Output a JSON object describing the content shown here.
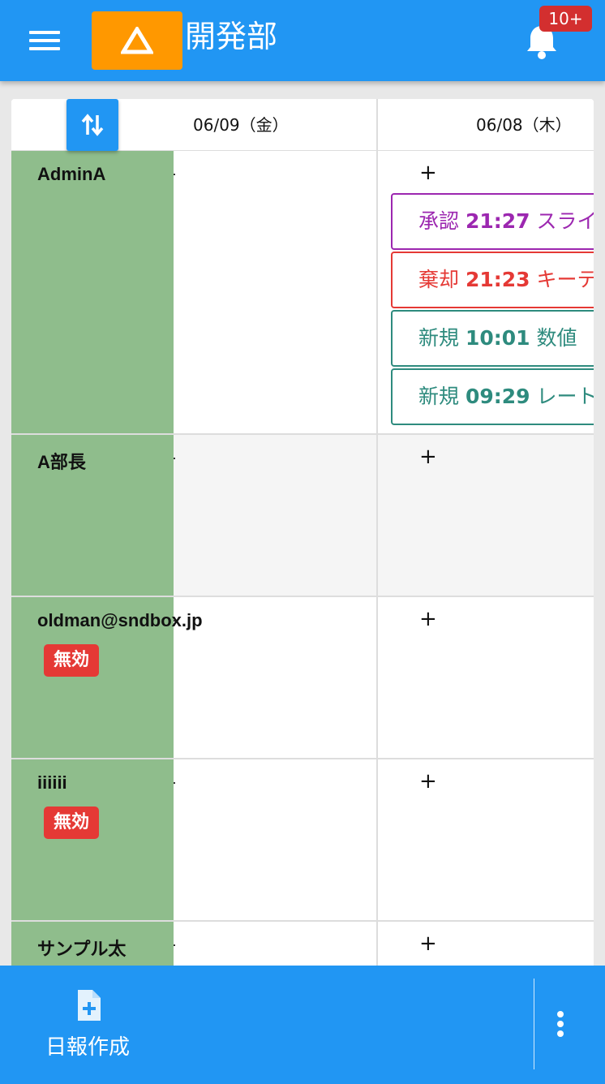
{
  "header": {
    "title": "開発部",
    "notification_count": "10+",
    "logo": "warning-triangle-logo"
  },
  "columns": [
    {
      "label": "06/09（金）"
    },
    {
      "label": "06/08（木）"
    }
  ],
  "rows": [
    {
      "name": "AdminA",
      "status": "",
      "dot": "·",
      "add": "+"
    },
    {
      "name": "A部長",
      "status": "",
      "dot": "·",
      "add": "+"
    },
    {
      "name": "oldman@sndbox.jp",
      "status": "無効",
      "dot": "·",
      "add": "+"
    },
    {
      "name": "iiiiii",
      "status": "無効",
      "dot": "·",
      "add": "+"
    },
    {
      "name": "サンプル太",
      "status": "",
      "dot": "·",
      "add": "+"
    }
  ],
  "reports": [
    {
      "type": "承認",
      "time": "21:27",
      "title": "スライ",
      "color": "#9c27b0"
    },
    {
      "type": "棄却",
      "time": "21:23",
      "title": "キーテ",
      "color": "#e53935"
    },
    {
      "type": "新規",
      "time": "10:01",
      "title": "数値",
      "color": "#2e8b7e"
    },
    {
      "type": "新規",
      "time": "09:29",
      "title": "レート",
      "color": "#2e8b7e"
    }
  ],
  "bottom_bar": {
    "create_label": "日報作成",
    "create_icon": "add-document-icon",
    "more_icon": "more-vertical-icon"
  },
  "colors": {
    "primary": "#2196f3",
    "accent": "#ff9800",
    "user_column": "#8fbd8c",
    "inactive": "#e53935"
  }
}
